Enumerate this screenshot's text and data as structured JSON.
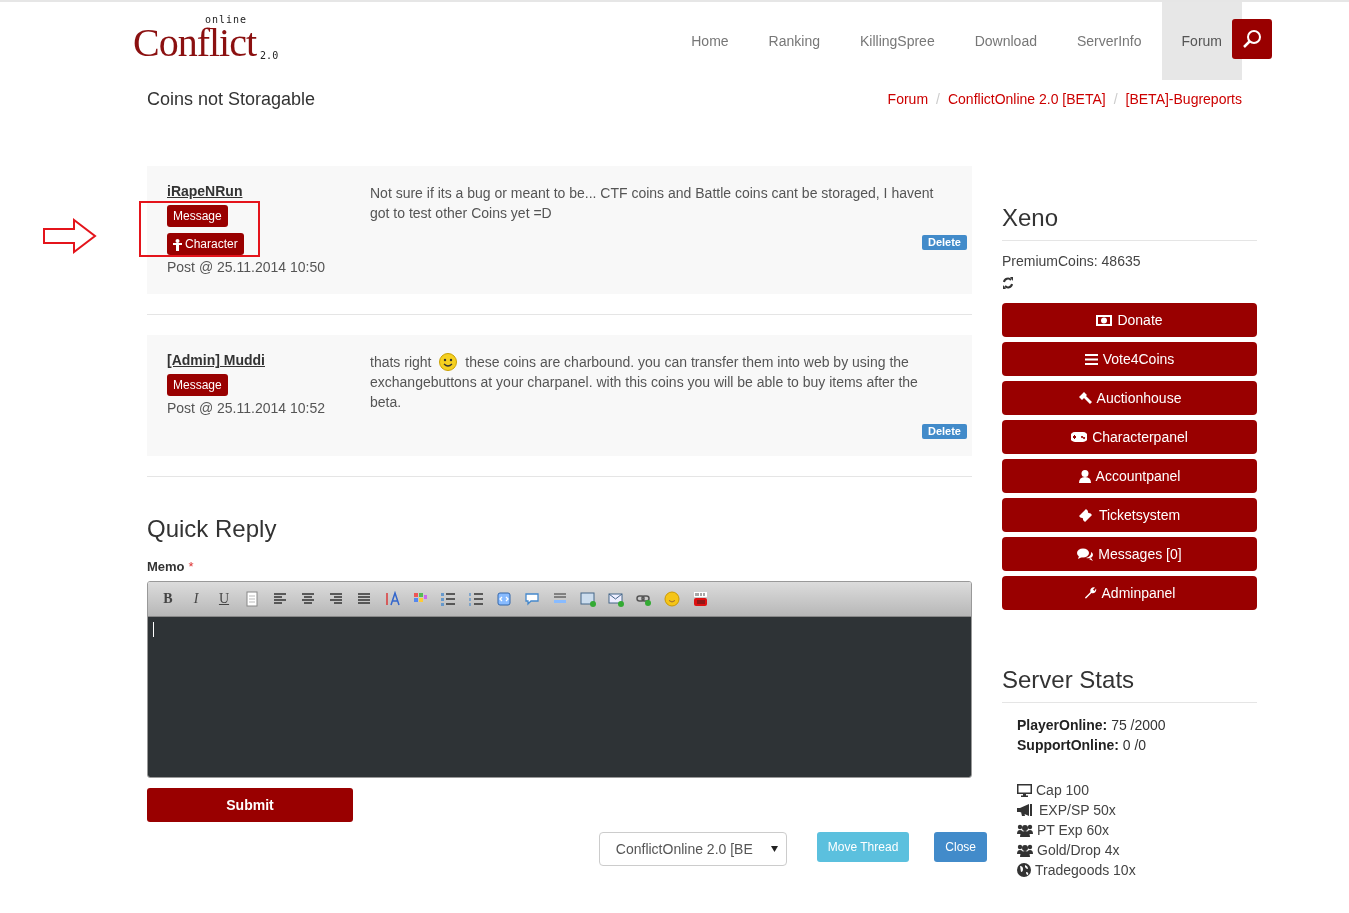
{
  "logo": {
    "tagline": "online",
    "wordmark": "Conflict",
    "version": "2.0"
  },
  "nav": [
    {
      "label": "Home",
      "selected": false
    },
    {
      "label": "Ranking",
      "selected": false
    },
    {
      "label": "KillingSpree",
      "selected": false
    },
    {
      "label": "Download",
      "selected": false
    },
    {
      "label": "ServerInfo",
      "selected": false
    },
    {
      "label": "Forum",
      "selected": true
    }
  ],
  "page_title": "Coins not Storagable",
  "breadcrumb": [
    {
      "kind": "link",
      "text": "Forum"
    },
    {
      "kind": "separator",
      "text": "/"
    },
    {
      "kind": "link",
      "text": "ConflictOnline 2.0 [BETA]"
    },
    {
      "kind": "separator",
      "text": "/"
    },
    {
      "kind": "link",
      "text": "[BETA]-Bugreports"
    }
  ],
  "posts": [
    {
      "author": "iRapeNRun",
      "buttons": [
        {
          "label": "Message",
          "kind": "message"
        },
        {
          "label": "Character",
          "kind": "character"
        }
      ],
      "date": "Post @ 25.11.2014 10:50",
      "body": [
        {
          "kind": "text",
          "text": "Not sure if its a bug or meant to be... CTF coins and Battle coins cant be storaged, I havent got to test other Coins yet =D"
        }
      ],
      "delete": "Delete",
      "highlighted": true
    },
    {
      "author": "[Admin] Muddi",
      "buttons": [
        {
          "label": "Message",
          "kind": "message"
        }
      ],
      "date": "Post @ 25.11.2014 10:52",
      "body": [
        {
          "kind": "text",
          "text": "thats right"
        },
        {
          "kind": "smiley"
        },
        {
          "kind": "text",
          "text": "these coins are charbound. you can transfer them into web by using the exchangebuttons at your charpanel. with this coins you will be able to buy items after the beta."
        }
      ],
      "delete": "Delete",
      "highlighted": false
    }
  ],
  "quick_reply": {
    "title": "Quick Reply",
    "memo_label": "Memo",
    "required_mark": "*",
    "toolbar_letters": [
      "B",
      "I",
      "U"
    ],
    "submit": "Submit"
  },
  "thread_actions": {
    "forum_select": "ConflictOnline 2.0 [BE",
    "move": "Move Thread",
    "close": "Close"
  },
  "account": {
    "name": "Xeno",
    "premium_coins": "PremiumCoins: 48635",
    "buttons": [
      {
        "label": "Donate",
        "kind": "money"
      },
      {
        "label": "Vote4Coins",
        "kind": "list"
      },
      {
        "label": "Auctionhouse",
        "kind": "gavel"
      },
      {
        "label": "Characterpanel",
        "kind": "gamepad"
      },
      {
        "label": "Accountpanel",
        "kind": "user"
      },
      {
        "label": "Ticketsystem",
        "kind": "ticket"
      },
      {
        "label": "Messages [0]",
        "kind": "comments"
      },
      {
        "label": "Adminpanel",
        "kind": "wrench"
      }
    ]
  },
  "server_stats": {
    "title": "Server Stats",
    "counts": [
      {
        "label": "PlayerOnline:",
        "value": "75 /2000"
      },
      {
        "label": "SupportOnline:",
        "value": "0 /0"
      }
    ],
    "features": [
      {
        "text": "Cap 100",
        "kind": "desktop"
      },
      {
        "text": "EXP/SP 50x",
        "kind": "bullhorn"
      },
      {
        "text": "PT Exp 60x",
        "kind": "users"
      },
      {
        "text": "Gold/Drop 4x",
        "kind": "users"
      },
      {
        "text": "Tradegoods 10x",
        "kind": "globe"
      }
    ]
  }
}
